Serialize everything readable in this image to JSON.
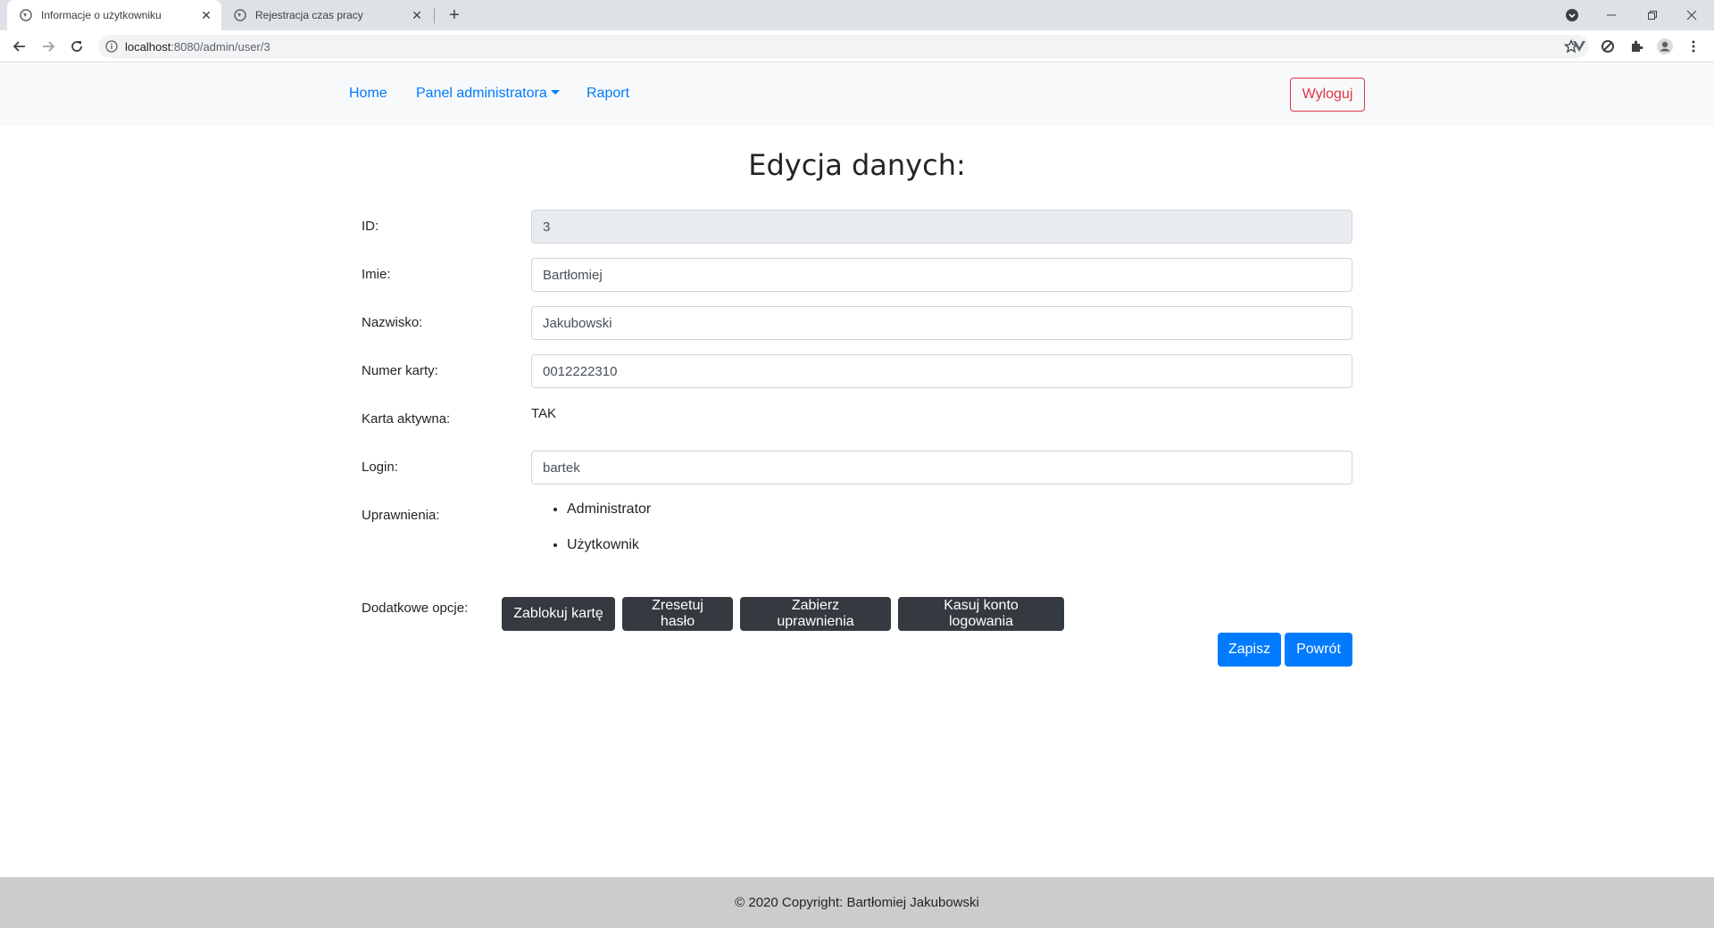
{
  "browser": {
    "tabs": [
      {
        "title": "Informacje o użytkowniku",
        "active": true
      },
      {
        "title": "Rejestracja czas pracy",
        "active": false
      }
    ],
    "url_host": "localhost",
    "url_path": ":8080/admin/user/3"
  },
  "navbar": {
    "home": "Home",
    "admin_panel": "Panel administratora",
    "report": "Raport",
    "logout": "Wyloguj"
  },
  "page": {
    "title": "Edycja danych:"
  },
  "form": {
    "id_label": "ID:",
    "id_value": "3",
    "first_name_label": "Imie:",
    "first_name_value": "Bartłomiej",
    "last_name_label": "Nazwisko:",
    "last_name_value": "Jakubowski",
    "card_number_label": "Numer karty:",
    "card_number_value": "0012222310",
    "card_active_label": "Karta aktywna:",
    "card_active_value": "TAK",
    "login_label": "Login:",
    "login_value": "bartek",
    "permissions_label": "Uprawnienia:",
    "permissions": [
      "Administrator",
      "Użytkownik"
    ],
    "extra_options_label": "Dodatkowe opcje:"
  },
  "actions": {
    "block_card": "Zablokuj kartę",
    "reset_password": "Zresetuj hasło",
    "revoke_permissions": "Zabierz uprawnienia",
    "delete_login": "Kasuj konto logowania",
    "save": "Zapisz",
    "back": "Powrót"
  },
  "footer": {
    "text": "© 2020 Copyright: Bartłomiej Jakubowski"
  },
  "colors": {
    "primary": "#007bff",
    "danger": "#dc3545",
    "dark": "#343a40",
    "footer_bg": "#cccccc"
  }
}
